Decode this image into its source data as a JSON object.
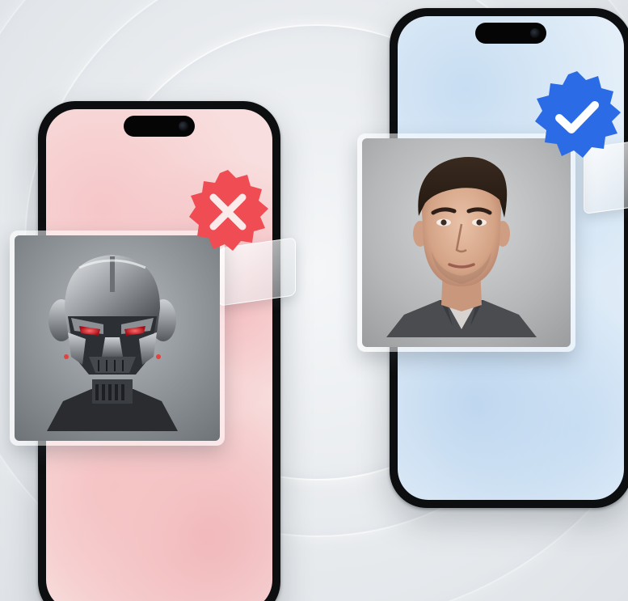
{
  "scene": {
    "left_phone": {
      "theme": "rejected",
      "screen_color": "#f8dede",
      "badge_icon": "x-mark-icon",
      "badge_color": "#ef4c54",
      "photo_subject": "robot-portrait"
    },
    "right_phone": {
      "theme": "verified",
      "screen_color": "#e3eef8",
      "badge_icon": "checkmark-icon",
      "badge_color": "#2b6be6",
      "photo_subject": "human-portrait"
    }
  }
}
